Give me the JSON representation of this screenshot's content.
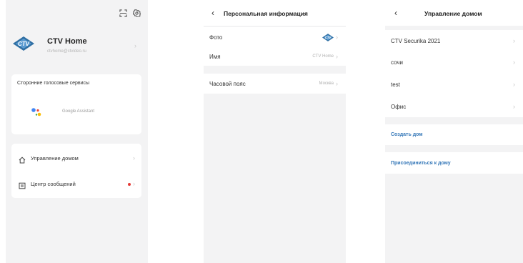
{
  "profile": {
    "app_name": "CTV Home",
    "email": "ctvhome@ctvideo.ru",
    "logo_text": "CTV",
    "voice_section_title": "Сторонние голосовые сервисы",
    "assistant_label": "Google Assistant",
    "menu": [
      {
        "label": "Управление домом",
        "icon": "home-icon",
        "badge": false
      },
      {
        "label": "Центр сообщений",
        "icon": "message-icon",
        "badge": true
      }
    ]
  },
  "personal_info": {
    "title": "Персональная информация",
    "rows": [
      {
        "label": "Фото",
        "value": ""
      },
      {
        "label": "Имя",
        "value": "CTV Home"
      },
      {
        "label": "Часовой пояс",
        "value": "Москва"
      }
    ]
  },
  "home_management": {
    "title": "Управление домом",
    "homes": [
      "CTV Securika 2021",
      "сочи",
      "test",
      "Офис"
    ],
    "create_label": "Создать дом",
    "join_label": "Присоединиться к дому"
  },
  "colors": {
    "accent_link": "#3477b8",
    "badge_red": "#e53935",
    "logo_blue": "#2f6fa3",
    "background": "#f3f3f4"
  }
}
